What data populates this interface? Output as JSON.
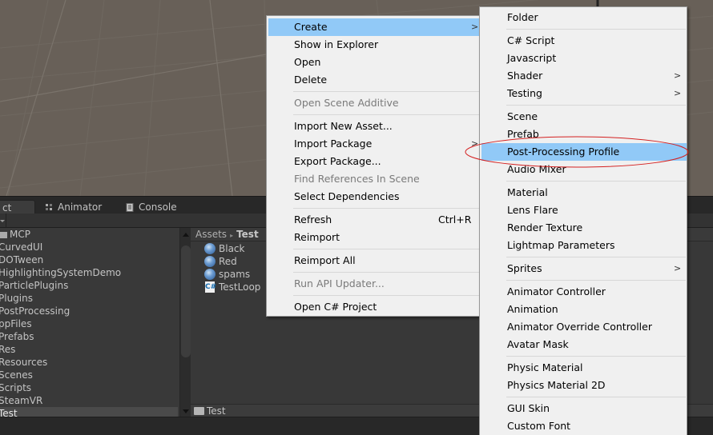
{
  "tabs": [
    {
      "label": "ct",
      "icon": "project-icon",
      "active": true
    },
    {
      "label": "Animator",
      "icon": "animator-icon",
      "active": false
    },
    {
      "label": "Console",
      "icon": "console-icon",
      "active": false
    }
  ],
  "tree": {
    "items": [
      {
        "label": "MCP",
        "folder": true
      },
      {
        "label": "CurvedUI"
      },
      {
        "label": "DOTween"
      },
      {
        "label": "HighlightingSystemDemo"
      },
      {
        "label": "ParticlePlugins"
      },
      {
        "label": "Plugins"
      },
      {
        "label": "PostProcessing"
      },
      {
        "label": "ppFiles"
      },
      {
        "label": "Prefabs"
      },
      {
        "label": "Res"
      },
      {
        "label": "Resources"
      },
      {
        "label": "Scenes"
      },
      {
        "label": "Scripts"
      },
      {
        "label": "SteamVR"
      },
      {
        "label": "Test",
        "selected": true
      }
    ]
  },
  "breadcrumb": {
    "root": "Assets",
    "separator": "▸",
    "current": "Test"
  },
  "assets": [
    {
      "label": "Black",
      "type": "material-sphere-icon"
    },
    {
      "label": "Red",
      "type": "material-sphere-icon"
    },
    {
      "label": "spams",
      "type": "material-sphere-icon"
    },
    {
      "label": "TestLoop",
      "type": "csharp-script-icon",
      "glyph": "C#"
    }
  ],
  "footer": {
    "path": "Test"
  },
  "context_menu": {
    "items": [
      {
        "label": "Create",
        "submenu": true,
        "highlighted": true
      },
      {
        "label": "Show in Explorer"
      },
      {
        "label": "Open"
      },
      {
        "label": "Delete"
      },
      {
        "separator": true
      },
      {
        "label": "Open Scene Additive",
        "disabled": true
      },
      {
        "separator": true
      },
      {
        "label": "Import New Asset..."
      },
      {
        "label": "Import Package",
        "submenu": true
      },
      {
        "label": "Export Package..."
      },
      {
        "label": "Find References In Scene",
        "disabled": true
      },
      {
        "label": "Select Dependencies"
      },
      {
        "separator": true
      },
      {
        "label": "Refresh",
        "shortcut": "Ctrl+R"
      },
      {
        "label": "Reimport"
      },
      {
        "separator": true
      },
      {
        "label": "Reimport All"
      },
      {
        "separator": true
      },
      {
        "label": "Run API Updater...",
        "disabled": true
      },
      {
        "separator": true
      },
      {
        "label": "Open C# Project"
      }
    ]
  },
  "create_submenu": {
    "items": [
      {
        "label": "Folder"
      },
      {
        "separator": true
      },
      {
        "label": "C# Script"
      },
      {
        "label": "Javascript"
      },
      {
        "label": "Shader",
        "submenu": true
      },
      {
        "label": "Testing",
        "submenu": true
      },
      {
        "separator": true
      },
      {
        "label": "Scene"
      },
      {
        "label": "Prefab"
      },
      {
        "label": "Post-Processing Profile",
        "highlighted": true,
        "annotated": true
      },
      {
        "label": "Audio Mixer"
      },
      {
        "separator": true
      },
      {
        "label": "Material"
      },
      {
        "label": "Lens Flare"
      },
      {
        "label": "Render Texture"
      },
      {
        "label": "Lightmap Parameters"
      },
      {
        "separator": true
      },
      {
        "label": "Sprites",
        "submenu": true
      },
      {
        "separator": true
      },
      {
        "label": "Animator Controller"
      },
      {
        "label": "Animation"
      },
      {
        "label": "Animator Override Controller"
      },
      {
        "label": "Avatar Mask"
      },
      {
        "separator": true
      },
      {
        "label": "Physic Material"
      },
      {
        "label": "Physics Material 2D"
      },
      {
        "separator": true
      },
      {
        "label": "GUI Skin"
      },
      {
        "label": "Custom Font"
      }
    ]
  },
  "colors": {
    "menu_highlight": "#91c9f7",
    "annotation_ellipse": "#d42020",
    "scene_background": "#686058"
  },
  "arrow_glyph": ">"
}
